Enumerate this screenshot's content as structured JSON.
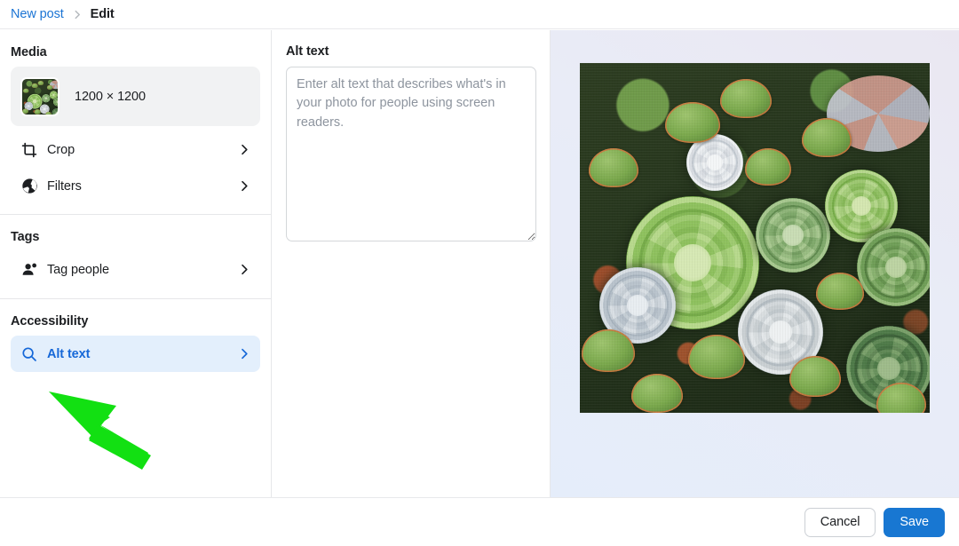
{
  "breadcrumb": {
    "parent_label": "New post",
    "separator_icon": "chevron-right-icon",
    "current_label": "Edit"
  },
  "sidebar": {
    "sections": [
      {
        "title": "Media",
        "media_card": {
          "thumbnail_icon": "image-thumbnail",
          "dimensions": "1200 × 1200"
        },
        "items": [
          {
            "label": "Crop",
            "icon": "crop-icon",
            "chevron": "chevron-right-icon",
            "active": false
          },
          {
            "label": "Filters",
            "icon": "aperture-icon",
            "chevron": "chevron-right-icon",
            "active": false
          }
        ]
      },
      {
        "title": "Tags",
        "items": [
          {
            "label": "Tag people",
            "icon": "tag-people-icon",
            "chevron": "chevron-right-icon",
            "active": false
          }
        ]
      },
      {
        "title": "Accessibility",
        "items": [
          {
            "label": "Alt text",
            "icon": "search-icon",
            "chevron": "chevron-right-icon",
            "active": true
          }
        ]
      }
    ]
  },
  "alt_text_panel": {
    "heading": "Alt text",
    "textarea_value": "",
    "textarea_placeholder": "Enter alt text that describes what's in your photo for people using screen readers."
  },
  "preview": {
    "image_description": "Overhead photo of a dense succulent garden with green and pale blue rosettes and red-tipped jade leaves"
  },
  "footer": {
    "cancel_label": "Cancel",
    "save_label": "Save"
  },
  "annotation": {
    "type": "arrow",
    "color": "#12e012",
    "points_at": "sidebar-item-alt-text"
  },
  "colors": {
    "link_blue": "#1b74d4",
    "active_row_bg": "#e3effc",
    "active_row_fg": "#1668d8",
    "save_blue": "#1877d2",
    "card_bg": "#f1f2f3",
    "border": "#e6e7e9",
    "text": "#1c1e21",
    "placeholder": "#8d949e",
    "annotation_green": "#12e012"
  }
}
